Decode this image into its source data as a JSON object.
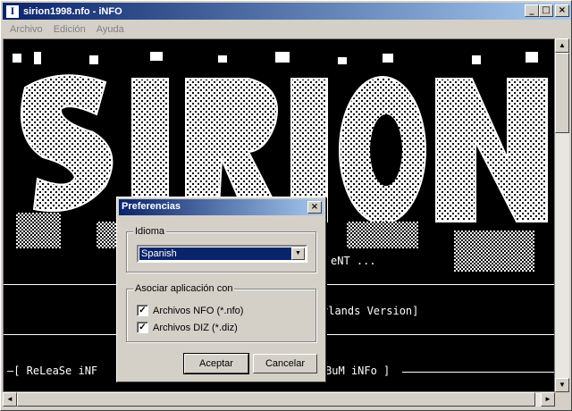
{
  "window": {
    "title": "sirion1998.nfo - iNFO",
    "icon": "I",
    "minimize": "_",
    "maximize": "□",
    "close": "×"
  },
  "menu": [
    "Archivo",
    "Edición",
    "Ayuda"
  ],
  "nfo": {
    "line_1_right": "eNT ...",
    "line_2_right": "rlands Version]",
    "line_3_left": "—[ ReLeaSe iNF",
    "line_3_right": "BuM iNFo ]"
  },
  "scrollbar": {
    "up": "▲",
    "down": "▼",
    "left": "◄",
    "right": "►"
  },
  "dialog": {
    "title": "Preferencias",
    "close": "×",
    "language_group": "Idioma",
    "language_value": "Spanish",
    "dropdown_arrow": "▼",
    "assoc_group": "Asociar aplicación con",
    "checkboxes": [
      {
        "label": "Archivos NFO (*.nfo)",
        "checked": "✓"
      },
      {
        "label": "Archivos DIZ (*.diz)",
        "checked": "✓"
      }
    ],
    "ok": "Aceptar",
    "cancel": "Cancelar"
  }
}
